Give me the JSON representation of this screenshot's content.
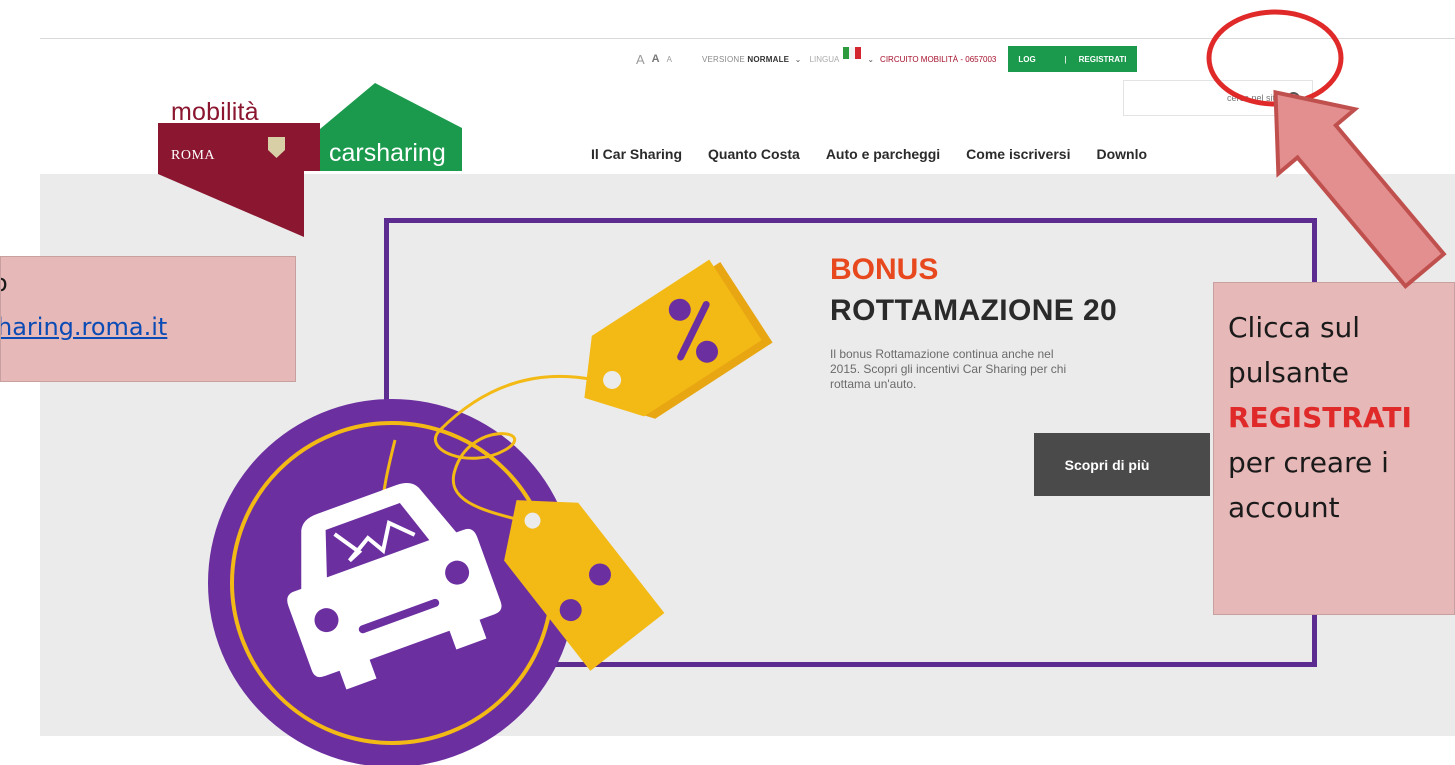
{
  "header": {
    "font_size_controls": [
      "A",
      "A",
      "A"
    ],
    "versione_label": "VERSIONE",
    "versione_value": "NORMALE",
    "lingua_label": "LINGUA",
    "circuito": "CIRCUITO MOBILITÀ - 0657003",
    "login_label": "LOG",
    "separator": "|",
    "registrati_label": "REGISTRATI",
    "search_placeholder": "cerca nel sito"
  },
  "logo": {
    "word": "mobilità",
    "city": "ROMA",
    "service": "carsharing"
  },
  "nav": {
    "items": [
      "Il Car Sharing",
      "Quanto Costa",
      "Auto e parcheggi",
      "Come iscriversi",
      "Downlo"
    ]
  },
  "hero": {
    "title_line1": "BONUS",
    "title_line2": "ROTTAMAZIONE 20",
    "description": "Il bonus Rottamazione continua anche nel\n2015. Scopri gli incentivi Car Sharing per chi\nrottama un'auto.",
    "cta_label": "Scopri di più"
  },
  "annotations": {
    "left_line1": "o",
    "left_link": "haring.roma.it",
    "right_line1": "Clicca sul",
    "right_line2": "pulsante",
    "right_line3": "REGISTRATI",
    "right_line4": "per creare i",
    "right_line5": "account"
  },
  "colors": {
    "brand_burgundy": "#8a1630",
    "brand_green": "#1b9a4d",
    "accent_purple": "#5d2c91",
    "accent_yellow": "#f3b914",
    "bonus_orange": "#e8481d",
    "annotation_pink": "#e6b8b7",
    "annotation_red": "#e02a2a"
  }
}
